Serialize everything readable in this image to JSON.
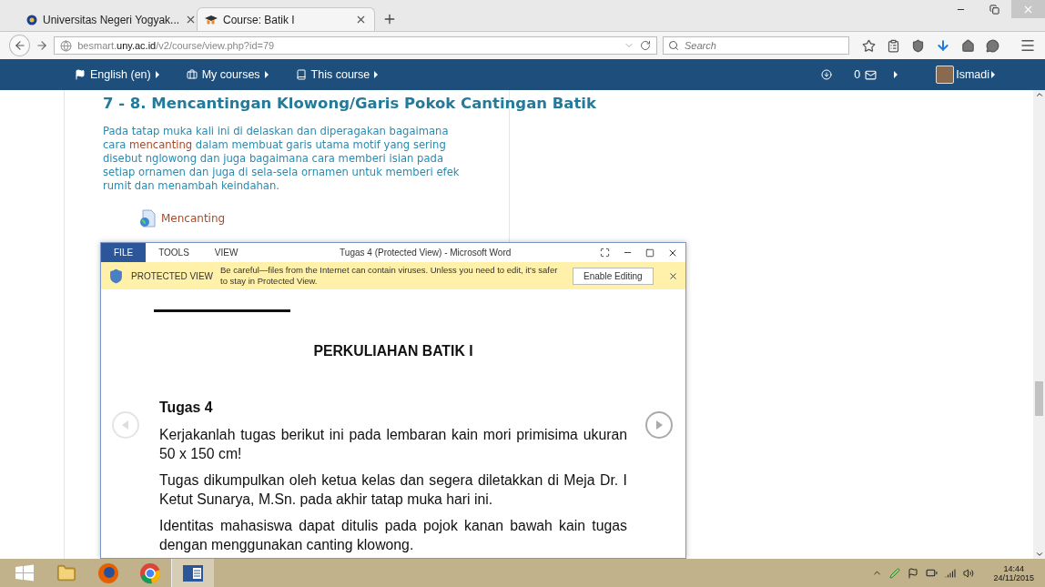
{
  "browser": {
    "tabs": [
      {
        "title": "Universitas Negeri Yogyak...",
        "kind": "university",
        "selected": false
      },
      {
        "title": "Course: Batik I",
        "kind": "moodle",
        "selected": true
      }
    ],
    "url": {
      "prefix": "besmart.",
      "domain": "uny.ac.id",
      "path": "/v2/course/view.php?id=79"
    },
    "search": {
      "placeholder": "Search"
    }
  },
  "navbar": {
    "menus": [
      {
        "label": "English (en)",
        "kind": "flag"
      },
      {
        "label": "My courses",
        "kind": "briefcase"
      },
      {
        "label": "This course",
        "kind": "book"
      }
    ],
    "messages_count": "0",
    "user": "Ismadi"
  },
  "content": {
    "heading": "7 - 8. Mencantingan Klowong/Garis Pokok Cantingan Batik",
    "paragraph": [
      {
        "text": "Pada tatap muka kali ini di delaskan dan diperagakan bagaimana cara ",
        "kind": "plain"
      },
      {
        "text": "mencanting",
        "kind": "link"
      },
      {
        "text": " dalam membuat garis utama motif yang sering disebut nglowong dan juga bagaimana cara memberi isian pada setiap ornamen dan juga di sela-sela ornamen untuk memberi efek rumit dan menambah keindahan.",
        "kind": "plain"
      }
    ],
    "resource": "Mencanting"
  },
  "word": {
    "title": "Tugas 4 (Protected View) - Microsoft Word",
    "menus": [
      {
        "label": "FILE",
        "selected": true
      },
      {
        "label": "TOOLS",
        "selected": false
      },
      {
        "label": "VIEW",
        "selected": false
      }
    ],
    "banner": {
      "label": "PROTECTED VIEW",
      "message": "Be careful—files from the Internet can contain viruses. Unless you need to edit, it's safer to stay in Protected View.",
      "button": "Enable Editing"
    },
    "document": {
      "heading": "PERKULIAHAN BATIK I",
      "subheading": "Tugas 4",
      "paragraphs": [
        "Kerjakanlah tugas berikut ini pada lembaran kain mori primisima ukuran 50 x 150 cm!",
        "Tugas dikumpulkan oleh ketua kelas dan segera diletakkan di Meja Dr. I Ketut Sunarya, M.Sn. pada akhir tatap muka hari ini.",
        "Identitas mahasiswa dapat ditulis pada pojok kanan bawah kain tugas dengan menggunakan canting klowong."
      ]
    }
  },
  "taskbar": {
    "apps": [
      {
        "kind": "explorer",
        "selected": false
      },
      {
        "kind": "firefox",
        "selected": false
      },
      {
        "kind": "chrome",
        "selected": false
      },
      {
        "kind": "word",
        "selected": true
      }
    ],
    "time": "14:44",
    "date": "24/11/2015"
  }
}
